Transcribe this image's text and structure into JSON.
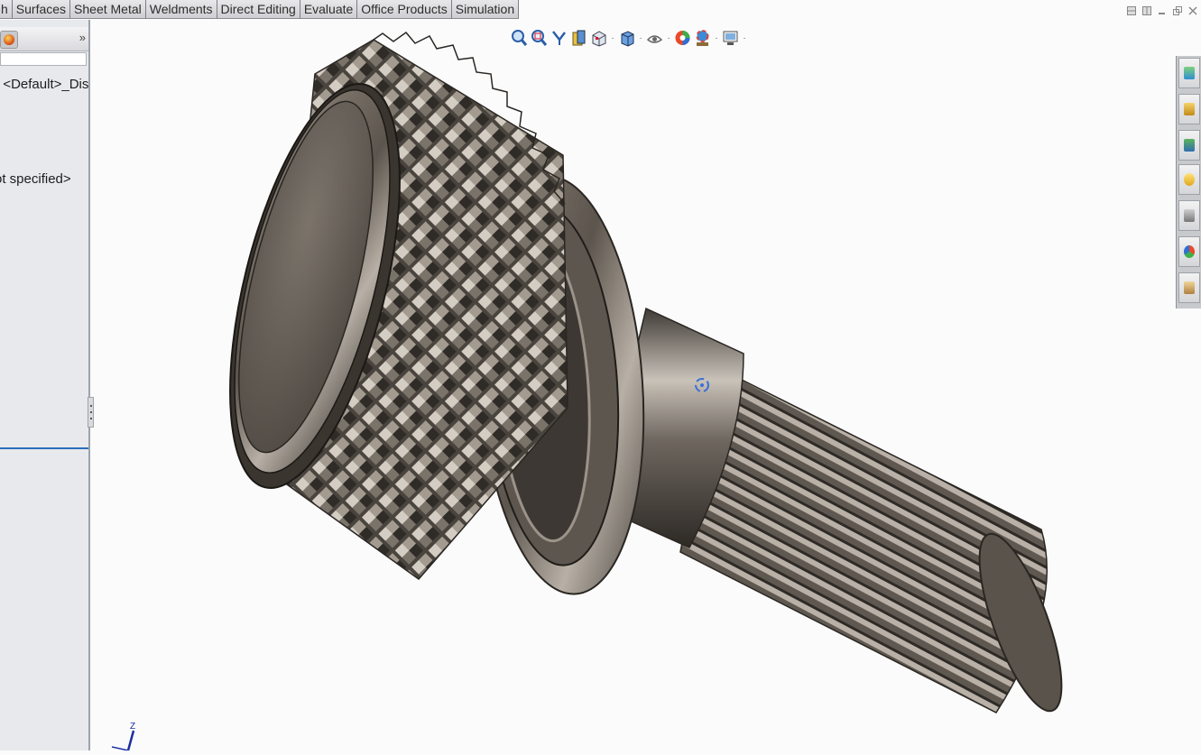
{
  "tabs": [
    "h",
    "Surfaces",
    "Sheet Metal",
    "Weldments",
    "Direct Editing",
    "Evaluate",
    "Office Products",
    "Simulation"
  ],
  "feature_tree": {
    "config_label": "t <Default>_Displ",
    "material_label": "ot specified>",
    "expand_glyph": "»"
  },
  "hud_icons": [
    "zoom-to-fit-icon",
    "zoom-to-area-icon",
    "previous-view-icon",
    "section-view-icon",
    "view-orientation-icon",
    "display-style-icon",
    "hide-show-items-icon",
    "edit-appearance-icon",
    "apply-scene-icon",
    "view-settings-icon"
  ],
  "task_pane_icons": [
    "solidworks-resources-icon",
    "design-library-icon",
    "file-explorer-icon",
    "view-palette-icon",
    "appearances-icon",
    "custom-properties-icon",
    "forum-icon"
  ],
  "triad": {
    "axis_label": "Z"
  },
  "colors": {
    "accent": "#2a6ebd",
    "part_metal": "#6b645c",
    "background": "#fbfbfc"
  }
}
